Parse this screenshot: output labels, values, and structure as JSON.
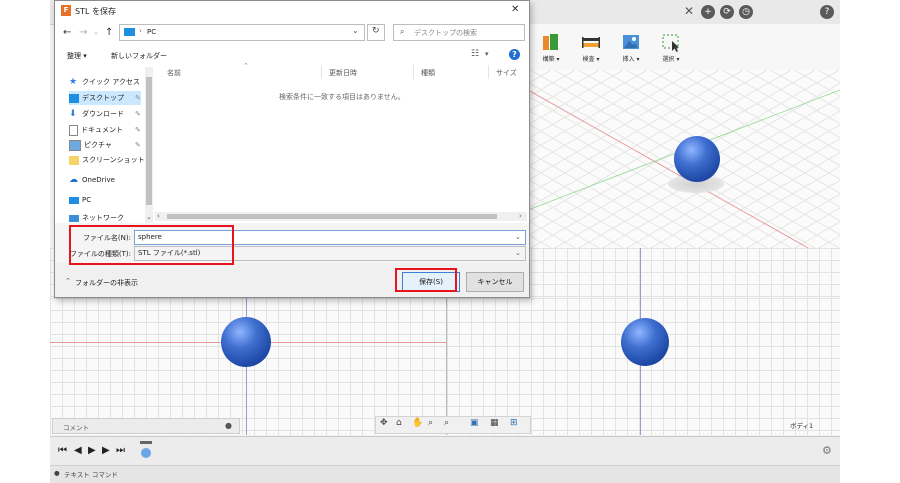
{
  "dialog": {
    "title": "STL を保存",
    "app_badge": "F",
    "close_glyph": "✕",
    "breadcrumb": "PC",
    "breadcrumb_sep": "›",
    "search_placeholder": "デスクトップの検索",
    "organize": "整理 ▾",
    "new_folder": "新しいフォルダー",
    "help": "?",
    "columns": {
      "name": "名前",
      "date": "更新日時",
      "type": "種類",
      "size": "サイズ"
    },
    "empty_message": "検索条件に一致する項目はありません。",
    "sidebar": [
      {
        "label": "クイック アクセス",
        "icon": "star-icon"
      },
      {
        "label": "デスクトップ",
        "icon": "desktop-icon",
        "pinned": true,
        "selected": true
      },
      {
        "label": "ダウンロード",
        "icon": "download-icon",
        "pinned": true
      },
      {
        "label": "ドキュメント",
        "icon": "document-icon",
        "pinned": true
      },
      {
        "label": "ピクチャ",
        "icon": "picture-icon",
        "pinned": true
      },
      {
        "label": "スクリーンショット",
        "icon": "folder-icon"
      },
      {
        "label": "OneDrive",
        "icon": "cloud-icon"
      },
      {
        "label": "PC",
        "icon": "pc-icon"
      },
      {
        "label": "ネットワーク",
        "icon": "network-icon"
      }
    ],
    "filename_label": "ファイル名(N):",
    "filename_value": "sphere",
    "filetype_label": "ファイルの種類(T):",
    "filetype_value": "STL ファイル(*.stl)",
    "hide_folders": "フォルダーの非表示",
    "save_button": "保存(S)",
    "cancel_button": "キャンセル"
  },
  "app": {
    "ribbon": [
      {
        "label": "構築 ▾",
        "icon": "build-icon"
      },
      {
        "label": "検査 ▾",
        "icon": "measure-icon"
      },
      {
        "label": "挿入 ▾",
        "icon": "insert-image-icon"
      },
      {
        "label": "選択 ▾",
        "icon": "select-icon"
      }
    ],
    "comment_label": "コメント",
    "body_label": "ボディ1",
    "text_command": "テキスト コマンド",
    "topbar_glyphs": {
      "close": "✕",
      "add": "+",
      "help": "?"
    }
  },
  "colors": {
    "highlight": "#e8141c",
    "accent": "#0078d7",
    "sphere": "#2d5cc0"
  }
}
